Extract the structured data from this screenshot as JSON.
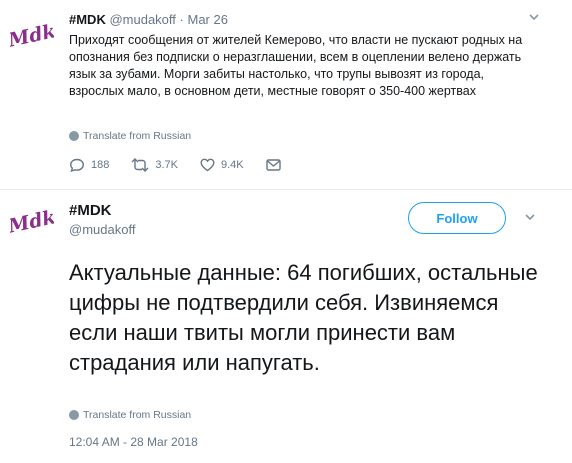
{
  "tweet1": {
    "avatar_logo_text": "Mdk",
    "display_name": "#MDK",
    "handle": "@mudakoff",
    "separator": "·",
    "date": "Mar 26",
    "text": "Приходят сообщения от жителей Кемерово, что власти не пускают родных на опознания без подписки о неразглашении, всем в оцеплении велено держать язык за зубами. Морги забиты настолько, что трупы вывозят из города, взрослых мало, в основном дети, местные говорят о 350-400 жертвах",
    "translate_label": "Translate from Russian",
    "actions": {
      "reply_count": "188",
      "retweet_count": "3.7K",
      "like_count": "9.4K"
    }
  },
  "tweet2": {
    "avatar_logo_text": "Mdk",
    "display_name": "#MDK",
    "handle": "@mudakoff",
    "follow_label": "Follow",
    "text": "Актуальные данные: 64 погибших, остальные цифры не подтвердили себя. Извиняемся если наши твиты могли принести вам страдания или напугать.",
    "translate_label": "Translate from Russian",
    "timestamp": "12:04 AM - 28 Mar 2018"
  },
  "colors": {
    "accent": "#1da1f2",
    "muted": "#657786",
    "logo": "#8a2e8c"
  }
}
